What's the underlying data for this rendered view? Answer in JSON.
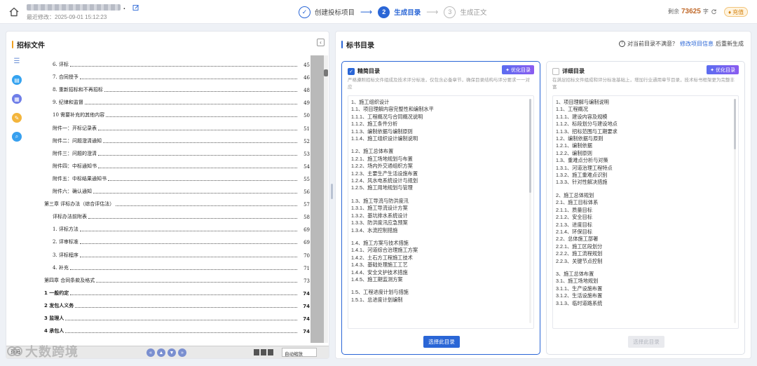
{
  "header": {
    "last_modified": "最近修改：2025-09-01 15:12:23",
    "steps": [
      {
        "index": "✓",
        "label": "创建投标项目",
        "state": "done"
      },
      {
        "index": "2",
        "label": "生成目录",
        "state": "active"
      },
      {
        "index": "3",
        "label": "生成正文",
        "state": "todo"
      }
    ],
    "remaining_label": "剩余",
    "remaining_value": "73625",
    "remaining_unit": "字",
    "recharge_label": "充值"
  },
  "left_panel": {
    "title": "招标文件",
    "toc": [
      {
        "label": "6.   评标",
        "page": "45",
        "indent": 12,
        "bold": false
      },
      {
        "label": "7.   合同授予",
        "page": "46",
        "indent": 12,
        "bold": false
      },
      {
        "label": "8.   重新招标和不再招标",
        "page": "48",
        "indent": 12,
        "bold": false
      },
      {
        "label": "9.   纪律和监督",
        "page": "49",
        "indent": 12,
        "bold": false
      },
      {
        "label": "10   需要补充的其他内容",
        "page": "50",
        "indent": 12,
        "bold": false
      },
      {
        "label": "附件一：开标记录表",
        "page": "51",
        "indent": 12,
        "bold": false
      },
      {
        "label": "附件二：问题澄清通知",
        "page": "52",
        "indent": 12,
        "bold": false
      },
      {
        "label": "附件三：问题的澄清",
        "page": "53",
        "indent": 12,
        "bold": false
      },
      {
        "label": "附件四：中标通知书",
        "page": "54",
        "indent": 12,
        "bold": false
      },
      {
        "label": "附件五：中标结果通知书",
        "page": "55",
        "indent": 12,
        "bold": false
      },
      {
        "label": "附件六：确认通知",
        "page": "56",
        "indent": 12,
        "bold": false
      },
      {
        "label": "第三章   评标办法（综合评估法）",
        "page": "57",
        "indent": 0,
        "bold": false
      },
      {
        "label": "评标办法前附表",
        "page": "58",
        "indent": 12,
        "bold": false
      },
      {
        "label": "1.   评标方法",
        "page": "69",
        "indent": 12,
        "bold": false
      },
      {
        "label": "2.   评审标准",
        "page": "69",
        "indent": 12,
        "bold": false
      },
      {
        "label": "3.   评标程序",
        "page": "70",
        "indent": 12,
        "bold": false
      },
      {
        "label": "4.   补充",
        "page": "71",
        "indent": 12,
        "bold": false
      },
      {
        "label": "第四章   合同条款及格式",
        "page": "73",
        "indent": 0,
        "bold": false
      },
      {
        "label": "1 一般约定",
        "page": "74",
        "indent": 0,
        "bold": true
      },
      {
        "label": "2 发包人义务",
        "page": "74",
        "indent": 0,
        "bold": true
      },
      {
        "label": "3 监理人",
        "page": "74",
        "indent": 0,
        "bold": true
      },
      {
        "label": "4 承包人",
        "page": "74",
        "indent": 0,
        "bold": true
      }
    ],
    "viewer": {
      "page_indicator": "页码",
      "zoom": "自动缩放"
    }
  },
  "right_panel": {
    "title": "标书目录",
    "hint_prefix": "对当前目录不满意？",
    "hint_link": "修改项目信息",
    "hint_suffix": "后重新生成",
    "cards": [
      {
        "name": "精简目录",
        "checked": true,
        "optimize_label": "优化目录",
        "description": "严格遵照招标文件组成及技术评分标准，仅包含必备章节，确保目录结构与评分要求一一对应",
        "select_label": "选择此目录",
        "enabled": true,
        "items": [
          "1、施工组织设计",
          "1.1、项目理解内容完整性和编制水平",
          "1.1.1、工程概况与合同概况说明",
          "1.1.2、施工条件分析",
          "1.1.3、编制依据与编制原则",
          "1.1.4、施工组织设计编制说明",
          "",
          "1.2、施工总体布置",
          "1.2.1、施工场地规划与布置",
          "1.2.2、场内外交通组织方案",
          "1.2.3、主要生产生活设施布置",
          "1.2.4、风水电系统设计与规划",
          "1.2.5、施工用地规划与管理",
          "",
          "1.3、施工导流与防洪度汛",
          "1.3.1、施工导流设计方案",
          "1.3.2、基坑排水系统设计",
          "1.3.3、防洪度汛应急预案",
          "1.3.4、水流控制措施",
          "",
          "1.4、施工方案与技术措施",
          "1.4.1、河道综合治理施工方案",
          "1.4.2、土石方工程施工技术",
          "1.4.3、基础处理施工工艺",
          "1.4.4、安全文护技术措施",
          "1.4.5、施工期监测方案",
          "",
          "1.5、工程进度计划与措施",
          "1.5.1、总进度计划编制"
        ]
      },
      {
        "name": "详细目录",
        "checked": false,
        "optimize_label": "优化目录",
        "description": "在满足招标文件组成和评分标准基础上，增加行业通用章节目录，技术标书框架更为完整丰富",
        "select_label": "选择此目录",
        "enabled": false,
        "items": [
          "1、项目理解与编制说明",
          "1.1、工程概况",
          "1.1.1、建设内容及规模",
          "1.1.2、标段划分与建设地点",
          "1.1.3、招标范围与工期要求",
          "1.2、编制依据与原则",
          "1.2.1、编制依据",
          "1.2.2、编制原则",
          "1.3、重难点分析与对策",
          "1.3.1、河道治理工程特点",
          "1.3.2、施工重难点识别",
          "1.3.3、针对性解决措施",
          "",
          "2、施工总体规划",
          "2.1、施工目标体系",
          "2.1.1、质量目标",
          "2.1.2、安全目标",
          "2.1.3、进度目标",
          "2.1.4、环保目标",
          "2.2、总体施工部署",
          "2.2.1、施工区段划分",
          "2.2.2、施工流程规划",
          "2.2.3、关键节点控制",
          "",
          "3、施工总体布置",
          "3.1、施工场地规划",
          "3.1.1、生产设施布置",
          "3.1.2、生活设施布置",
          "3.1.3、临时道路系统"
        ]
      }
    ]
  },
  "watermark": "大数跨境",
  "colors": {
    "primary": "#2a66d6",
    "accent_orange": "#f0a020",
    "remaining_number": "#c0692a"
  }
}
